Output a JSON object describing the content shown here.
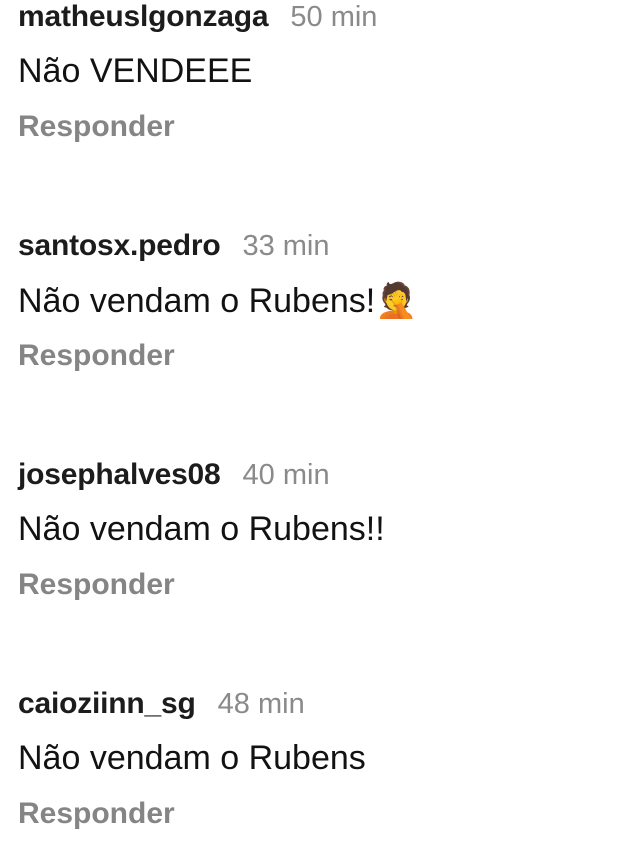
{
  "comments": [
    {
      "username": "matheuslgonzaga",
      "time": "50 min",
      "text": "Não VENDEEE",
      "emoji": "",
      "reply_label": "Responder"
    },
    {
      "username": "santosx.pedro",
      "time": "33 min",
      "text": "Não vendam o Rubens!",
      "emoji": "🤦",
      "reply_label": "Responder"
    },
    {
      "username": "josephalves08",
      "time": "40 min",
      "text": "Não vendam o Rubens!!",
      "emoji": "",
      "reply_label": "Responder"
    },
    {
      "username": "caioziinn_sg",
      "time": "48 min",
      "text": "Não vendam o Rubens",
      "emoji": "",
      "reply_label": "Responder"
    }
  ],
  "icons": {
    "facepalm": "face-palm-emoji"
  }
}
